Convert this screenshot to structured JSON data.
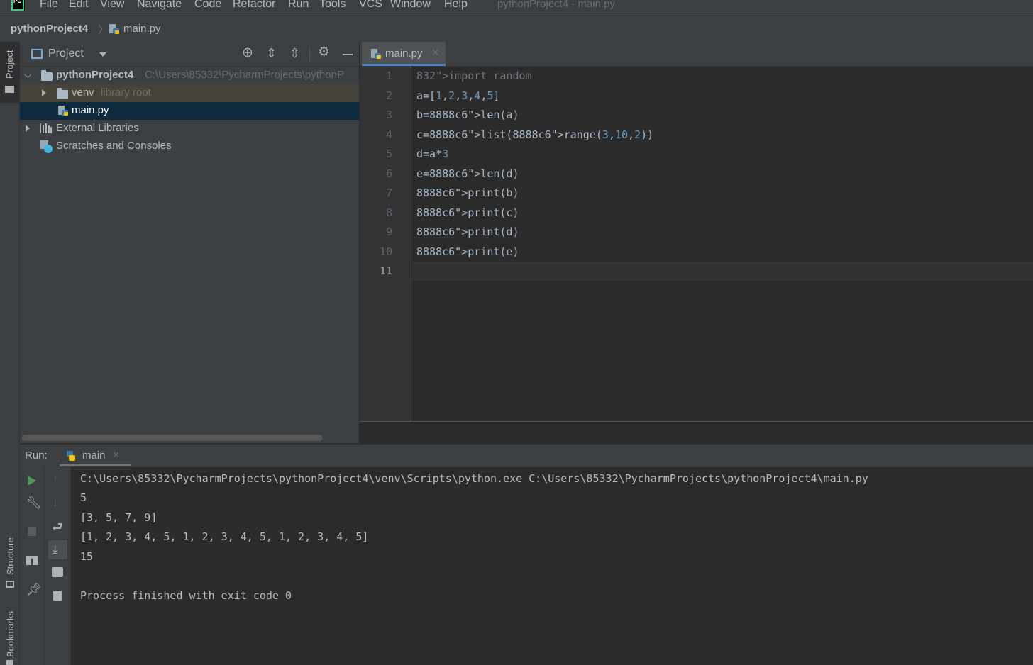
{
  "app": {
    "logo_text": "PC",
    "window_title": "pythonProject4 - main.py"
  },
  "menu": [
    "File",
    "Edit",
    "View",
    "Navigate",
    "Code",
    "Refactor",
    "Run",
    "Tools",
    "VCS",
    "Window",
    "Help"
  ],
  "breadcrumb": {
    "project": "pythonProject4",
    "file": "main.py"
  },
  "left_strip": {
    "project_tab": "Project",
    "structure_tab": "Structure",
    "bookmarks_tab": "Bookmarks"
  },
  "project_panel": {
    "title": "Project",
    "tree": {
      "root_name": "pythonProject4",
      "root_path": "C:\\Users\\85332\\PycharmProjects\\pythonP",
      "venv_name": "venv",
      "venv_hint": "library root",
      "file": "main.py",
      "external": "External Libraries",
      "scratches": "Scratches and Consoles"
    }
  },
  "editor": {
    "tab": "main.py",
    "line_numbers": [
      "1",
      "2",
      "3",
      "4",
      "5",
      "6",
      "7",
      "8",
      "9",
      "10",
      "11"
    ],
    "lines": [
      "import random",
      "a=[1,2,3,4,5]",
      "b=len(a)",
      "c=list(range(3,10,2))",
      "d=a*3",
      "e=len(d)",
      "print(b)",
      "print(c)",
      "print(d)",
      "print(e)",
      ""
    ]
  },
  "run_panel": {
    "label": "Run:",
    "config": "main",
    "output": [
      "C:\\Users\\85332\\PycharmProjects\\pythonProject4\\venv\\Scripts\\python.exe C:\\Users\\85332\\PycharmProjects\\pythonProject4\\main.py",
      "5",
      "[3, 5, 7, 9]",
      "[1, 2, 3, 4, 5, 1, 2, 3, 4, 5, 1, 2, 3, 4, 5]",
      "15",
      "",
      "Process finished with exit code 0"
    ]
  },
  "colors": {
    "keyword": "#cc7832",
    "number": "#6897bb",
    "builtin": "#8888c6",
    "accent": "#4a88c7",
    "run_green": "#499c54"
  }
}
